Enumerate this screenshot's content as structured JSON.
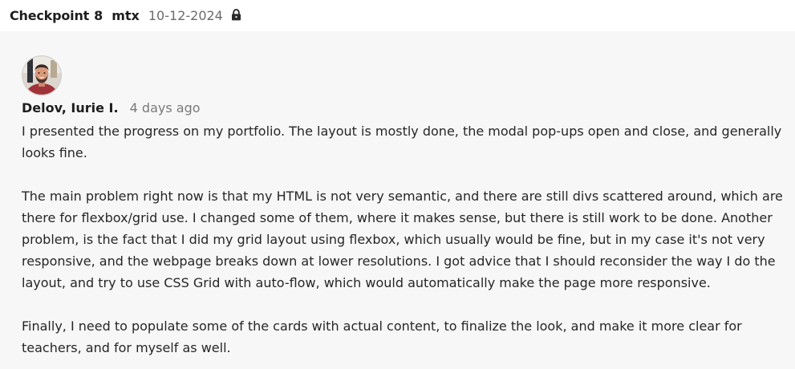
{
  "header": {
    "title": "Checkpoint",
    "number": "8",
    "tag": "mtx",
    "date": "10-12-2024",
    "lock_icon": "lock-icon"
  },
  "comment": {
    "author": "Delov, Iurie I.",
    "time": "4 days ago",
    "avatar_icon": "user-avatar-photo",
    "paragraphs": [
      "I presented the progress on my portfolio. The layout is mostly done, the modal pop-ups open and close, and generally looks fine.",
      "The main problem right now is that my HTML is not very semantic, and there are still divs scattered around, which are there for flexbox/grid use. I changed some of them, where it makes sense, but there is still work to be done. Another problem, is the fact that I did my grid layout using flexbox, which usually would be fine, but in my case it's not very responsive, and the webpage breaks down at lower resolutions. I got advice that I should reconsider the way I do the layout, and try to use CSS Grid with auto-flow, which would automatically make the page more responsive.",
      "Finally, I need to populate some of the cards with actual content, to finalize the look, and make it more clear for teachers, and for myself as well."
    ]
  }
}
